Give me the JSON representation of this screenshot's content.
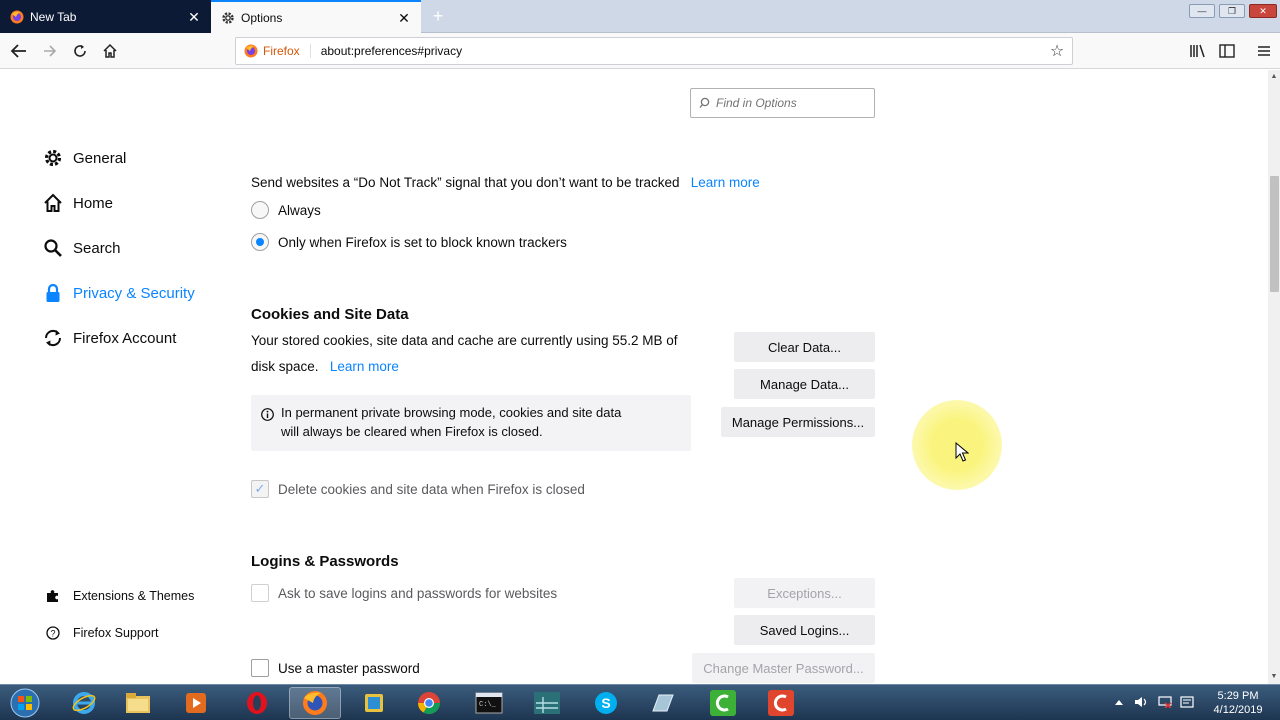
{
  "tabs": [
    {
      "label": "New Tab",
      "icon": "firefox-icon"
    },
    {
      "label": "Options",
      "icon": "gear-icon"
    }
  ],
  "urlbar": {
    "identity": "Firefox",
    "url": "about:preferences#privacy"
  },
  "search": {
    "placeholder": "Find in Options"
  },
  "sidebar": {
    "items": [
      {
        "label": "General",
        "icon": "gear-icon"
      },
      {
        "label": "Home",
        "icon": "home-icon"
      },
      {
        "label": "Search",
        "icon": "search-icon"
      },
      {
        "label": "Privacy & Security",
        "icon": "lock-icon",
        "selected": true
      },
      {
        "label": "Firefox Account",
        "icon": "sync-icon"
      }
    ],
    "footer": [
      {
        "label": "Extensions & Themes",
        "icon": "puzzle-icon"
      },
      {
        "label": "Firefox Support",
        "icon": "help-icon"
      }
    ]
  },
  "dnt": {
    "text": "Send websites a “Do Not Track” signal that you don’t want to be tracked",
    "learn_more": "Learn more",
    "options": [
      {
        "label": "Always",
        "checked": false
      },
      {
        "label": "Only when Firefox is set to block known trackers",
        "checked": true
      }
    ]
  },
  "cookies": {
    "heading": "Cookies and Site Data",
    "desc_line1": "Your stored cookies, site data and cache are currently using 55.2 MB of",
    "desc_line2": "disk space.",
    "learn_more": "Learn more",
    "info_line1": "In permanent private browsing mode, cookies and site data",
    "info_line2": "will always be cleared when Firefox is closed.",
    "delete_label": "Delete cookies and site data when Firefox is closed",
    "delete_checked": true,
    "buttons": {
      "clear": "Clear Data...",
      "manage": "Manage Data...",
      "permissions": "Manage Permissions..."
    }
  },
  "logins": {
    "heading": "Logins & Passwords",
    "ask_label": "Ask to save logins and passwords for websites",
    "master_label": "Use a master password",
    "buttons": {
      "exceptions": "Exceptions...",
      "saved": "Saved Logins...",
      "change_master": "Change Master Password..."
    }
  },
  "taskbar": {
    "time": "5:29 PM",
    "date": "4/12/2019",
    "apps": [
      "start-button",
      "internet-explorer-icon",
      "file-explorer-icon",
      "media-player-icon",
      "opera-icon",
      "firefox-icon",
      "app-icon",
      "chrome-icon",
      "terminal-icon",
      "app-icon",
      "skype-icon",
      "app-icon",
      "camtasia-icon",
      "camtasia-recorder-icon"
    ]
  },
  "colors": {
    "accent": "#0a84ff",
    "highlight": "#faf478"
  }
}
